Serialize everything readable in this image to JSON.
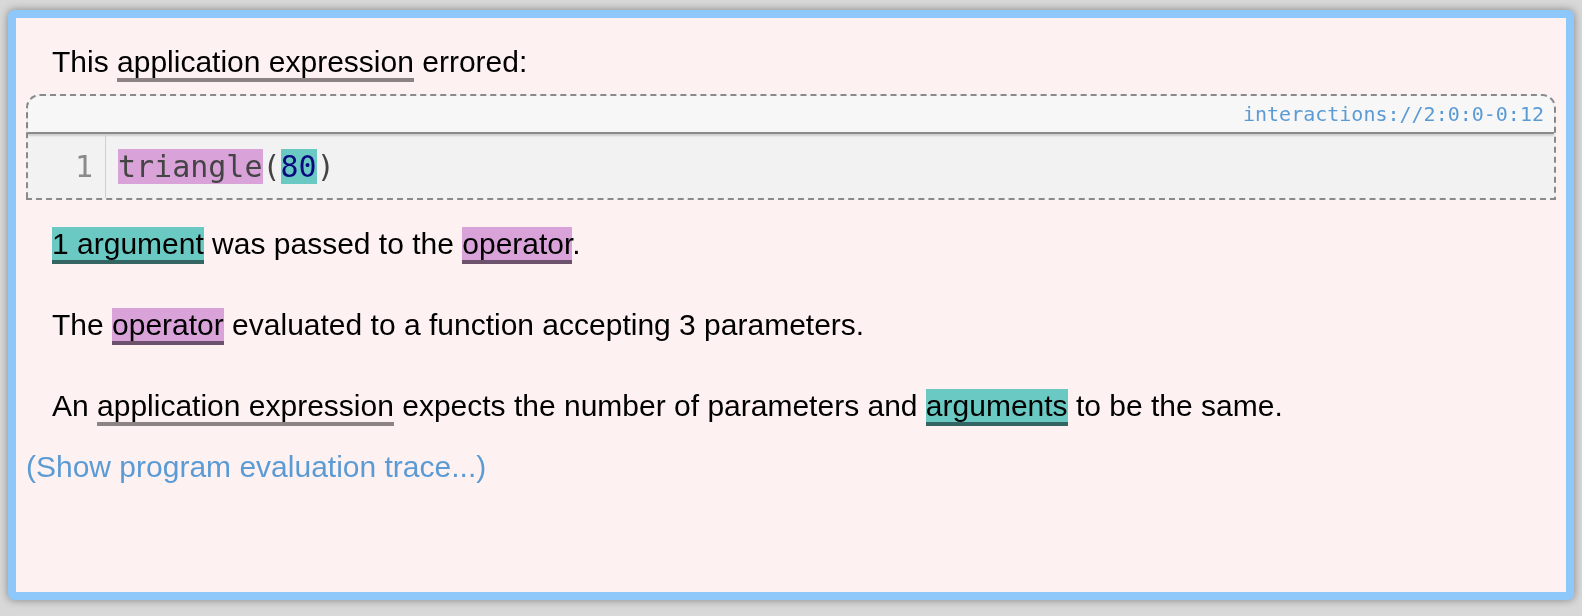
{
  "intro": [
    {
      "text": "This ",
      "kind": "plain"
    },
    {
      "text": "application expression",
      "kind": "term"
    },
    {
      "text": " errored:",
      "kind": "plain"
    }
  ],
  "code": {
    "source": "interactions://2:0:0-0:12",
    "lines": [
      {
        "number": "1",
        "tokens": [
          {
            "text": "triangle",
            "kind": "highlight",
            "color": "#d9a3d9"
          },
          {
            "text": "(",
            "kind": "plain"
          },
          {
            "text": "80",
            "kind": "number",
            "color": "#6ac9c3"
          },
          {
            "text": ")",
            "kind": "plain"
          }
        ]
      }
    ]
  },
  "paragraphs": [
    [
      {
        "text": "1 argument",
        "kind": "highlight",
        "color": "#6ac9c3"
      },
      {
        "text": " was passed to the ",
        "kind": "plain"
      },
      {
        "text": "operator",
        "kind": "highlight",
        "color": "#d9a3d9"
      },
      {
        "text": ".",
        "kind": "plain"
      }
    ],
    [
      {
        "text": "The ",
        "kind": "plain"
      },
      {
        "text": "operator",
        "kind": "highlight",
        "color": "#d9a3d9"
      },
      {
        "text": " evaluated to a function accepting 3 parameters.",
        "kind": "plain"
      }
    ],
    [
      {
        "text": "An ",
        "kind": "plain"
      },
      {
        "text": "application expression",
        "kind": "term"
      },
      {
        "text": " expects the number of parameters and ",
        "kind": "plain"
      },
      {
        "text": "arguments",
        "kind": "highlight",
        "color": "#6ac9c3"
      },
      {
        "text": " to be the same.",
        "kind": "plain"
      }
    ]
  ],
  "trace_link": "(Show program evaluation trace...)"
}
